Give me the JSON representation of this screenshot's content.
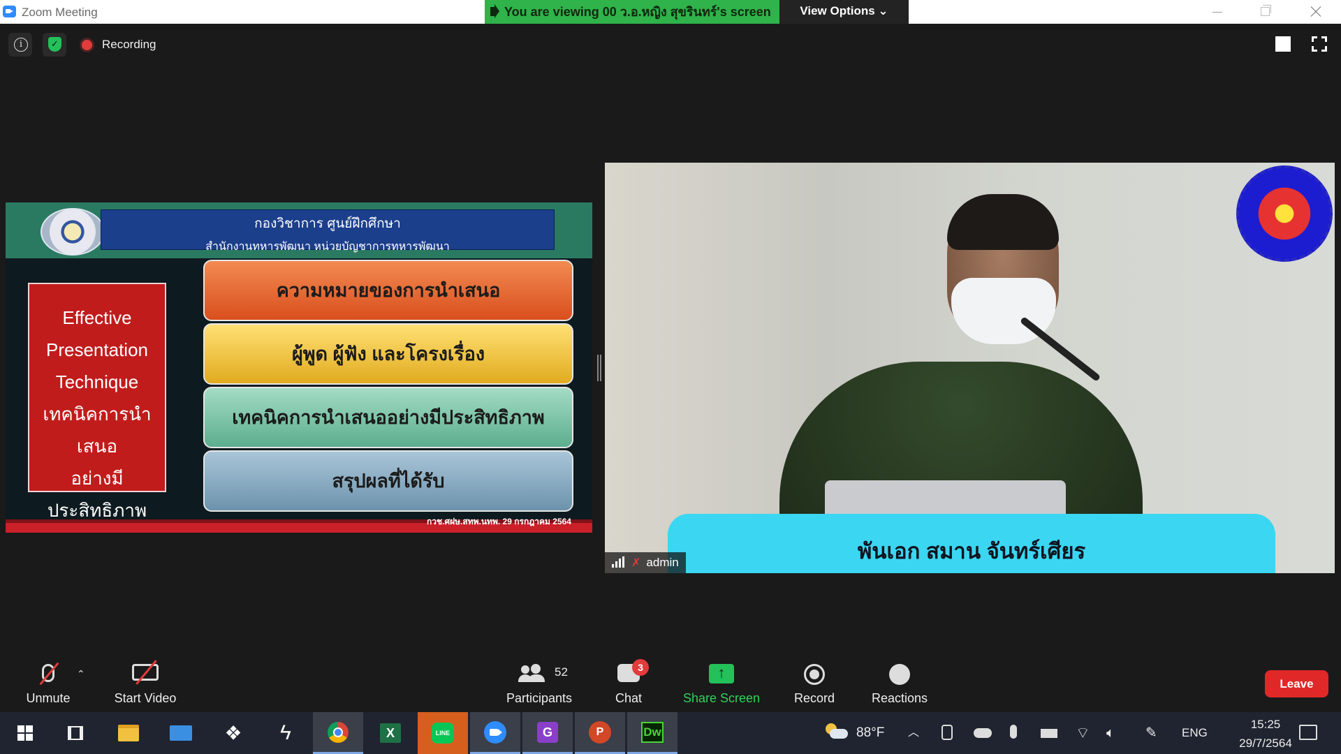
{
  "window": {
    "title": "Zoom Meeting",
    "banner_text": "You are viewing 00 ว.อ.หญิง สุขรินทร์'s screen",
    "view_options": "View Options ⌄"
  },
  "meeting": {
    "recording_label": "Recording"
  },
  "slide": {
    "org_line1": "กองวิชาการ ศูนย์ฝึกศึกษา",
    "org_line2": "สำนักงานทหารพัฒนา หน่วยบัญชาการทหารพัฒนา",
    "side_title": [
      "Effective",
      "Presentation",
      "Technique",
      "เทคนิคการนำเสนอ",
      "อย่างมีประสิทธิภาพ"
    ],
    "menu": [
      "ความหมายของการนำเสนอ",
      "ผู้พูด ผู้ฟัง และโครงเรื่อง",
      "เทคนิคการนำเสนออย่างมีประสิทธิภาพ",
      "สรุปผลที่ได้รับ"
    ],
    "footer": "กวช.ศฝษ.สทพ.นทพ.   29 กรกฎาคม 2564"
  },
  "video": {
    "name_caption": "พันเอก สมาน  จันทร์เศียร",
    "participant_label": "admin"
  },
  "toolbar": {
    "unmute": "Unmute",
    "start_video": "Start Video",
    "participants": "Participants",
    "participants_count": "52",
    "chat": "Chat",
    "chat_badge": "3",
    "share_screen": "Share Screen",
    "record": "Record",
    "reactions": "Reactions",
    "leave": "Leave"
  },
  "taskbar": {
    "weather": "88°F",
    "language": "ENG",
    "time": "15:25",
    "date": "29/7/2564"
  },
  "colors": {
    "accent_green": "#2fb34a",
    "leave_red": "#e02828",
    "zoom_blue": "#2d8cff"
  }
}
